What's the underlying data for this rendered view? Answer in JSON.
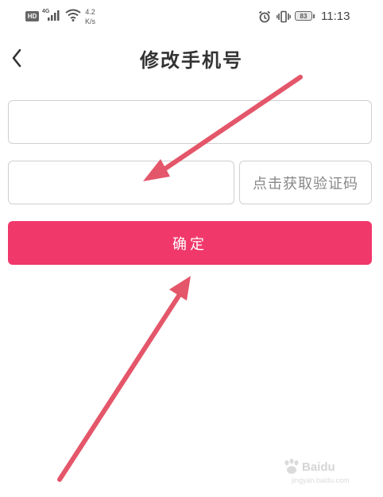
{
  "status_bar": {
    "hd_label": "HD",
    "network_label": "4G",
    "speed_value": "4.2",
    "speed_unit": "K/s",
    "battery_level": "83",
    "time": "11:13"
  },
  "header": {
    "title": "修改手机号"
  },
  "form": {
    "phone_placeholder": "",
    "code_placeholder": "",
    "get_code_label": "点击获取验证码",
    "confirm_label": "确定"
  },
  "watermark": {
    "brand": "Baidu",
    "sub": "jingyan.baidu.com"
  },
  "colors": {
    "accent": "#f0386b",
    "annotation": "#e4566a",
    "border": "#cfcfcf"
  },
  "icons": [
    "back-chevron-icon",
    "hd-icon",
    "signal-icon",
    "wifi-icon",
    "alarm-icon",
    "vibrate-icon",
    "battery-icon"
  ]
}
